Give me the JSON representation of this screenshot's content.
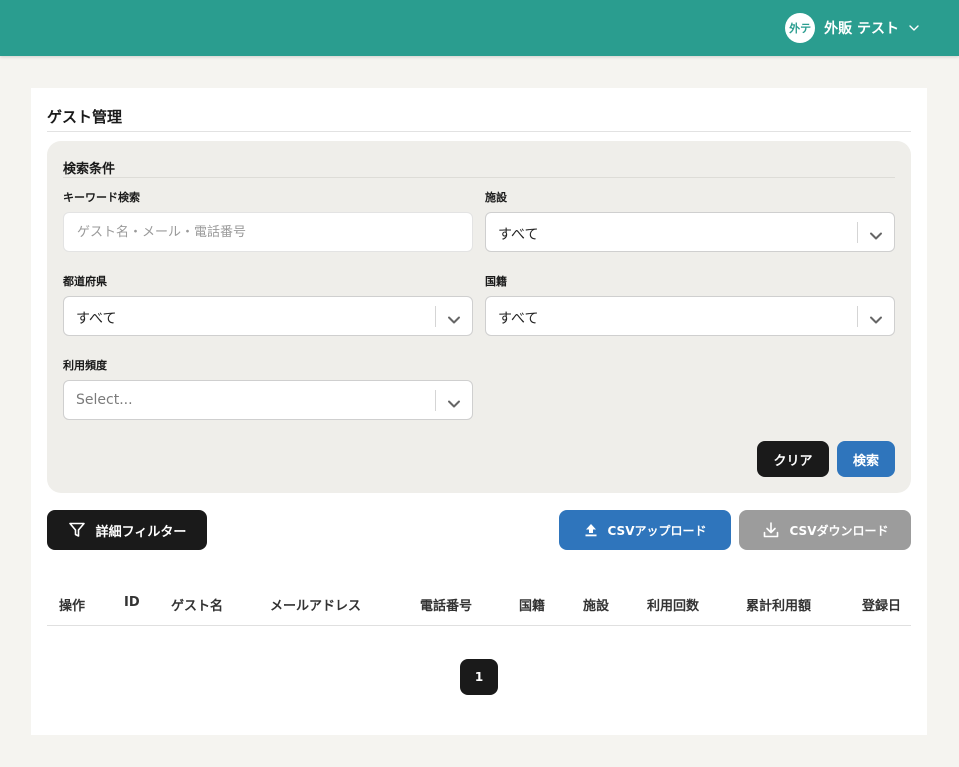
{
  "header": {
    "avatar_text": "外テ",
    "user_name": "外販 テスト",
    "colors": {
      "bar": "#2a9d8f"
    }
  },
  "page": {
    "title": "ゲスト管理"
  },
  "search": {
    "title": "検索条件",
    "keyword": {
      "label": "キーワード検索",
      "placeholder": "ゲスト名・メール・電話番号",
      "value": ""
    },
    "facility": {
      "label": "施設",
      "value": "すべて"
    },
    "prefecture": {
      "label": "都道府県",
      "value": "すべて"
    },
    "nationality": {
      "label": "国籍",
      "value": "すべて"
    },
    "frequency": {
      "label": "利用頻度",
      "placeholder": "Select..."
    },
    "clear_label": "クリア",
    "search_label": "検索"
  },
  "toolbar": {
    "filter_label": "詳細フィルター",
    "upload_label": "CSVアップロード",
    "download_label": "CSVダウンロード"
  },
  "table": {
    "columns": [
      "操作",
      "ID",
      "ゲスト名",
      "メールアドレス",
      "電話番号",
      "国籍",
      "施設",
      "利用回数",
      "累計利用額",
      "登録日"
    ]
  },
  "pagination": {
    "current_page": "1"
  },
  "colors": {
    "primary_blue": "#2f75bc",
    "dark": "#1a1a1a",
    "disabled_gray": "#9c9c9c"
  },
  "icons": {
    "user_chevron": "chevron-down-icon",
    "select_chevron": "chevron-down-icon",
    "filter": "funnel-icon",
    "upload": "upload-icon",
    "download": "download-icon"
  }
}
